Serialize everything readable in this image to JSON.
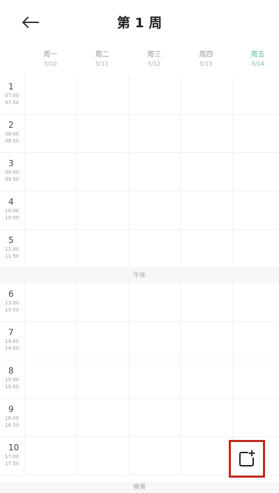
{
  "header": {
    "title": "第 1 周",
    "back_icon": "arrow-left-icon"
  },
  "days": [
    {
      "name": "周一",
      "date": "5/10",
      "current": false
    },
    {
      "name": "周二",
      "date": "5/11",
      "current": false
    },
    {
      "name": "周三",
      "date": "5/12",
      "current": false
    },
    {
      "name": "周四",
      "date": "5/13",
      "current": false
    },
    {
      "name": "周五",
      "date": "5/14",
      "current": true
    }
  ],
  "periods": [
    {
      "num": "1",
      "start": "07:00",
      "end": "07:50"
    },
    {
      "num": "2",
      "start": "08:00",
      "end": "08:50"
    },
    {
      "num": "3",
      "start": "09:00",
      "end": "09:50"
    },
    {
      "num": "4",
      "start": "10:00",
      "end": "10:50"
    },
    {
      "num": "5",
      "start": "11:00",
      "end": "11:50"
    },
    {
      "num": "6",
      "start": "13:00",
      "end": "13:50"
    },
    {
      "num": "7",
      "start": "14:00",
      "end": "14:50"
    },
    {
      "num": "8",
      "start": "15:00",
      "end": "15:50"
    },
    {
      "num": "9",
      "start": "16:00",
      "end": "16:50"
    },
    {
      "num": "10",
      "start": "17:00",
      "end": "17:50"
    }
  ],
  "breaks": {
    "noon": "午休",
    "evening": "晚餐"
  },
  "add_button": {
    "icon": "add-schedule-icon"
  },
  "colors": {
    "accent": "#5cb8a6",
    "highlight_border": "#c0291d"
  }
}
